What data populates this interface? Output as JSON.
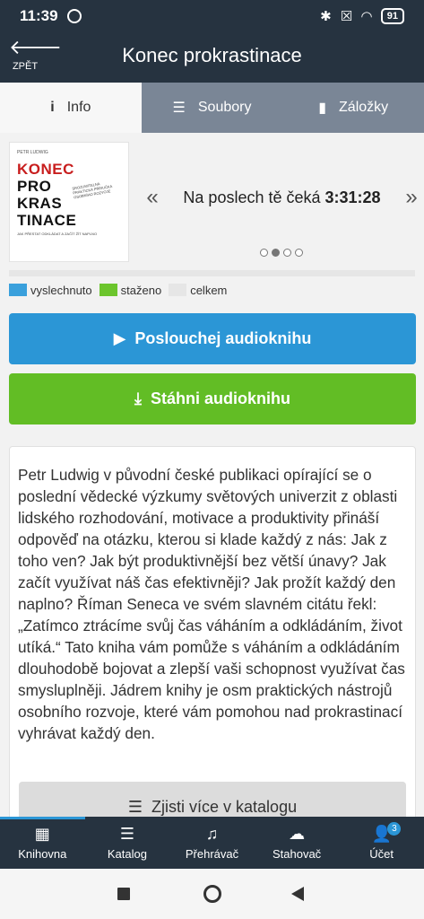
{
  "status": {
    "time": "11:39",
    "battery": "91"
  },
  "appbar": {
    "back_label": "ZPĚT",
    "title": "Konec prokrastinace"
  },
  "tabs": [
    {
      "label": "Info",
      "icon": "info-icon",
      "active": true
    },
    {
      "label": "Soubory",
      "icon": "list-icon",
      "active": false
    },
    {
      "label": "Záložky",
      "icon": "bookmark-icon",
      "active": false
    }
  ],
  "cover": {
    "author": "PETR LUDWIG",
    "title_lines": [
      "KONEC",
      "PRO",
      "KRAS",
      "TINACE"
    ],
    "subtitle": "JAK PŘESTAT ODKLÁDAT A ZAČÍT ŽÍT NAPLNO",
    "note": "SROZUMITELNÁ PRAKTICKÁ PŘÍRUČKA OSOBNÍHO ROZVOJE"
  },
  "info_slider": {
    "prefix": "Na poslech tě čeká ",
    "value": "3:31:28",
    "dots": 4,
    "active_dot": 1
  },
  "progress": {
    "heard": 0.0,
    "downloaded": 0.0
  },
  "legend": [
    {
      "label": "vyslechnuto",
      "color": "#3aa0dc"
    },
    {
      "label": "staženo",
      "color": "#6cc52d"
    },
    {
      "label": "celkem",
      "color": "#e6e6e6"
    }
  ],
  "buttons": {
    "play": "Poslouchej audioknihu",
    "download": "Stáhni audioknihu",
    "catalog": "Zjisti více v katalogu"
  },
  "description": "Petr Ludwig v původní české publikaci opírající se o poslední vědecké výzkumy světových univerzit z oblasti lidského rozhodování, motivace a produktivity přináší odpověď na otázku, kterou si klade každý z nás: Jak z toho ven? Jak být produktivnější bez větší únavy? Jak začít využívat náš čas efektivněji? Jak prožít každý den naplno? Říman Seneca ve svém slavném citátu řekl: „Zatímco ztrácíme svůj čas váháním a odkládáním, život utíká.“ Tato kniha vám pomůže s váháním a odkládáním dlouhodobě bojovat a zlepší vaši schopnost využívat čas smysluplněji. Jádrem knihy je osm praktických nástrojů osobního rozvoje, které vám pomohou nad prokrastinací vyhrávat každý den.",
  "bottom_nav": [
    {
      "label": "Knihovna",
      "icon": "library-grid-icon"
    },
    {
      "label": "Katalog",
      "icon": "catalog-list-icon"
    },
    {
      "label": "Přehrávač",
      "icon": "music-note-icon"
    },
    {
      "label": "Stahovač",
      "icon": "cloud-download-icon"
    },
    {
      "label": "Účet",
      "icon": "user-icon",
      "badge": "3"
    }
  ]
}
